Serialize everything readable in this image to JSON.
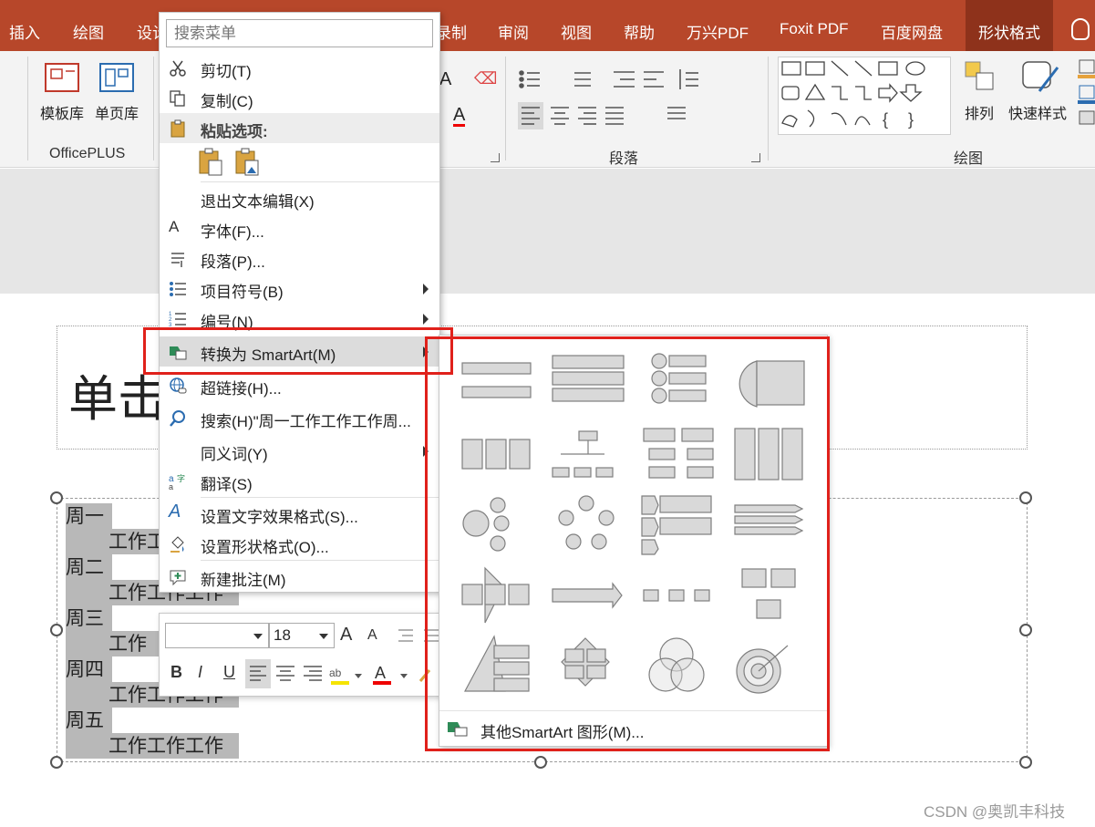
{
  "ribbon": {
    "tabs": [
      "插入",
      "绘图",
      "设计",
      "录制",
      "审阅",
      "视图",
      "帮助",
      "万兴PDF",
      "Foxit PDF",
      "百度网盘",
      "形状格式"
    ],
    "active_tab": "形状格式",
    "groups": {
      "officeplus": {
        "label": "OfficePLUS",
        "btn1": "模板库",
        "btn2": "单页库"
      },
      "paragraph": {
        "label": "段落"
      },
      "drawing": {
        "label": "绘图",
        "arrange": "排列",
        "quick_styles": "快速样式"
      }
    }
  },
  "slide": {
    "title_placeholder": "单击",
    "body_lines": [
      "周一",
      "工作工",
      "周二",
      "工作工作工作",
      "周三",
      "工作",
      "周四",
      "工作工作工作",
      "周五",
      "工作工作工作"
    ]
  },
  "context_menu": {
    "search_placeholder": "搜索菜单",
    "items": {
      "cut": "剪切(T)",
      "copy": "复制(C)",
      "paste_options": "粘贴选项:",
      "exit_edit": "退出文本编辑(X)",
      "font": "字体(F)...",
      "paragraph": "段落(P)...",
      "bullets": "项目符号(B)",
      "numbering": "编号(N)",
      "convert_smartart": "转换为 SmartArt(M)",
      "hyperlink": "超链接(H)...",
      "search": "搜索(H)\"周一工作工作工作周...",
      "synonyms": "同义词(Y)",
      "translate": "翻译(S)",
      "text_effects": "设置文字效果格式(S)...",
      "shape_format": "设置形状格式(O)...",
      "new_comment": "新建批注(M)"
    }
  },
  "mini_toolbar": {
    "font_name": "",
    "font_size": "18",
    "bold": "B",
    "italic": "I",
    "underline": "U",
    "grow": "A",
    "shrink": "A"
  },
  "smartart_submenu": {
    "more": "其他SmartArt 图形(M)..."
  },
  "colors": {
    "ribbon": "#b7472a",
    "active_tab": "#8e321b",
    "highlight_box": "#e0211b"
  },
  "watermark": "CSDN @奥凯丰科技"
}
